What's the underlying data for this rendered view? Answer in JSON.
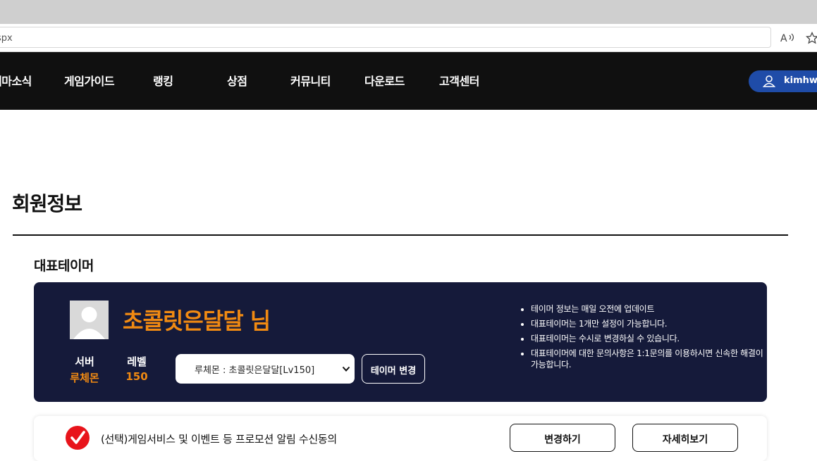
{
  "browser": {
    "url_fragment": "spx"
  },
  "nav": {
    "items": [
      "테마소식",
      "게임가이드",
      "랭킹",
      "상점",
      "커뮤니티",
      "다운로드",
      "고객센터"
    ],
    "user_name": "kimhwa"
  },
  "page": {
    "title": "회원정보",
    "section_title": "대표테이머"
  },
  "rep_tamer": {
    "name": "초콜릿은달달 님",
    "server_label": "서버",
    "server_value": "루체몬",
    "level_label": "레벨",
    "level_value": "150",
    "select_value": "루체몬 : 초콜릿은달달[Lv150]",
    "change_button": "테이머 변경",
    "notes": [
      "테이머 정보는 매일 오전에 업데이트",
      "대표테이머는 1개만 설정이 가능합니다.",
      "대표테이머는 수시로 변경하실 수 있습니다.",
      "대표테이머에 대한 문의사항은 1:1문의를 이용하시면 신속한 해결이 가능합니다."
    ]
  },
  "consent": {
    "text": "(선택)게임서비스 및 이벤트 등 프로모션 알림 수신동의",
    "checked": true,
    "change_button": "변경하기",
    "detail_button": "자세히보기"
  },
  "colors": {
    "nav_bg": "#101010",
    "card_bg": "#151a3a",
    "accent_orange": "#f18a12",
    "user_pill": "#1f4ca8",
    "check_red": "#e8141b"
  }
}
